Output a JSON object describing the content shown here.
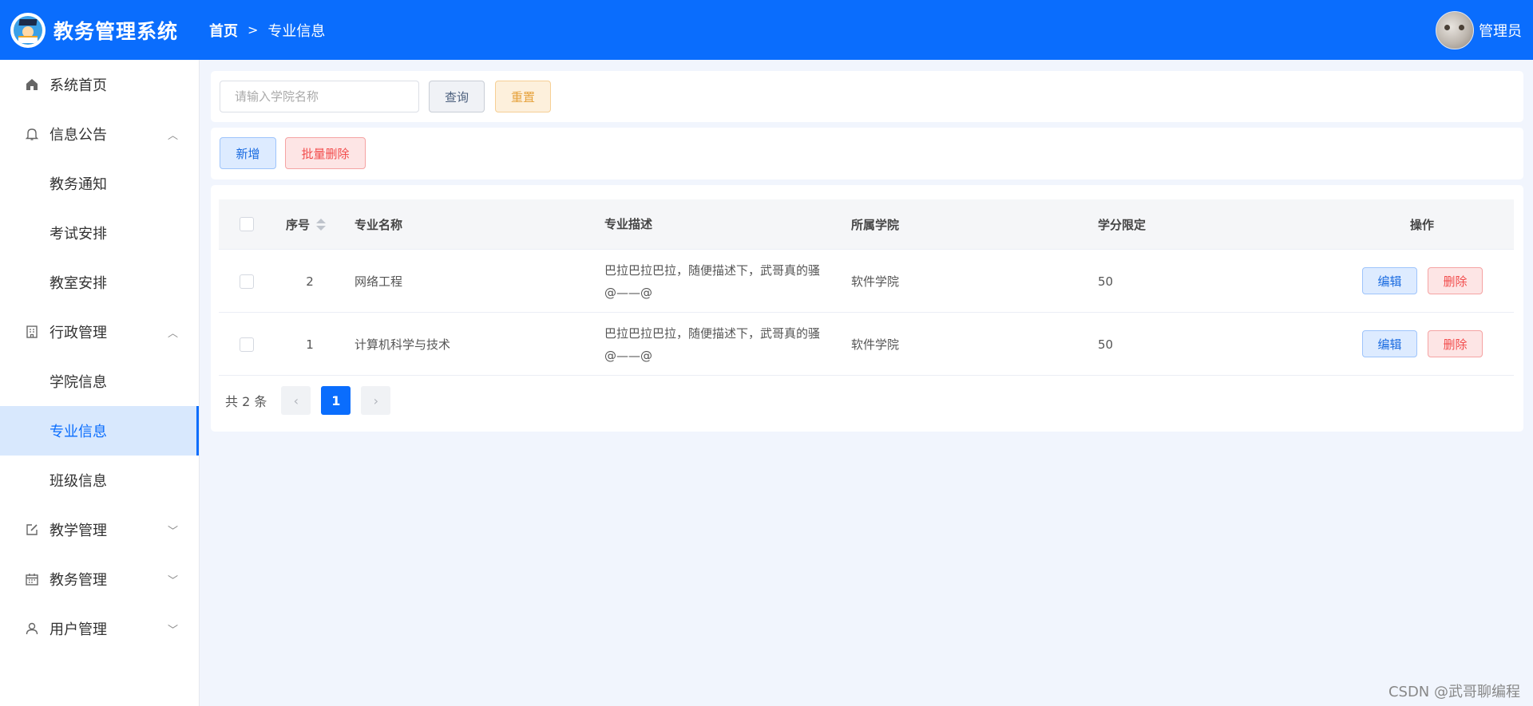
{
  "app": {
    "title": "教务管理系统"
  },
  "breadcrumb": {
    "home": "首页",
    "current": "专业信息"
  },
  "user": {
    "name": "管理员"
  },
  "sidebar": {
    "items": [
      {
        "label": "系统首页",
        "icon": "home-icon"
      },
      {
        "label": "信息公告",
        "icon": "bell-icon",
        "expanded": true,
        "children": [
          {
            "label": "教务通知"
          },
          {
            "label": "考试安排"
          },
          {
            "label": "教室安排"
          }
        ]
      },
      {
        "label": "行政管理",
        "icon": "building-icon",
        "expanded": true,
        "children": [
          {
            "label": "学院信息"
          },
          {
            "label": "专业信息",
            "active": true
          },
          {
            "label": "班级信息"
          }
        ]
      },
      {
        "label": "教学管理",
        "icon": "edit-icon"
      },
      {
        "label": "教务管理",
        "icon": "calendar-icon"
      },
      {
        "label": "用户管理",
        "icon": "user-icon"
      }
    ]
  },
  "search": {
    "placeholder": "请输入学院名称",
    "value": "",
    "query_label": "查询",
    "reset_label": "重置"
  },
  "actions": {
    "add_label": "新增",
    "batch_delete_label": "批量删除"
  },
  "table": {
    "headers": {
      "seq": "序号",
      "name": "专业名称",
      "desc": "专业描述",
      "college": "所属学院",
      "credit": "学分限定",
      "ops": "操作"
    },
    "rows": [
      {
        "seq": "2",
        "name": "网络工程",
        "desc_line1": "巴拉巴拉巴拉，随便描述下，武哥真的骚",
        "desc_line2": "@——@",
        "college": "软件学院",
        "credit": "50"
      },
      {
        "seq": "1",
        "name": "计算机科学与技术",
        "desc_line1": "巴拉巴拉巴拉，随便描述下，武哥真的骚",
        "desc_line2": "@——@",
        "college": "软件学院",
        "credit": "50"
      }
    ],
    "edit_label": "编辑",
    "delete_label": "删除"
  },
  "pagination": {
    "total_text": "共 2 条",
    "current_page": "1",
    "prev": "‹",
    "next": "›"
  },
  "watermark": "CSDN @武哥聊编程",
  "colors": {
    "primary": "#0a6dfd",
    "danger": "#f24b4b",
    "warning": "#e6a23c",
    "background": "#f1f5fd"
  }
}
